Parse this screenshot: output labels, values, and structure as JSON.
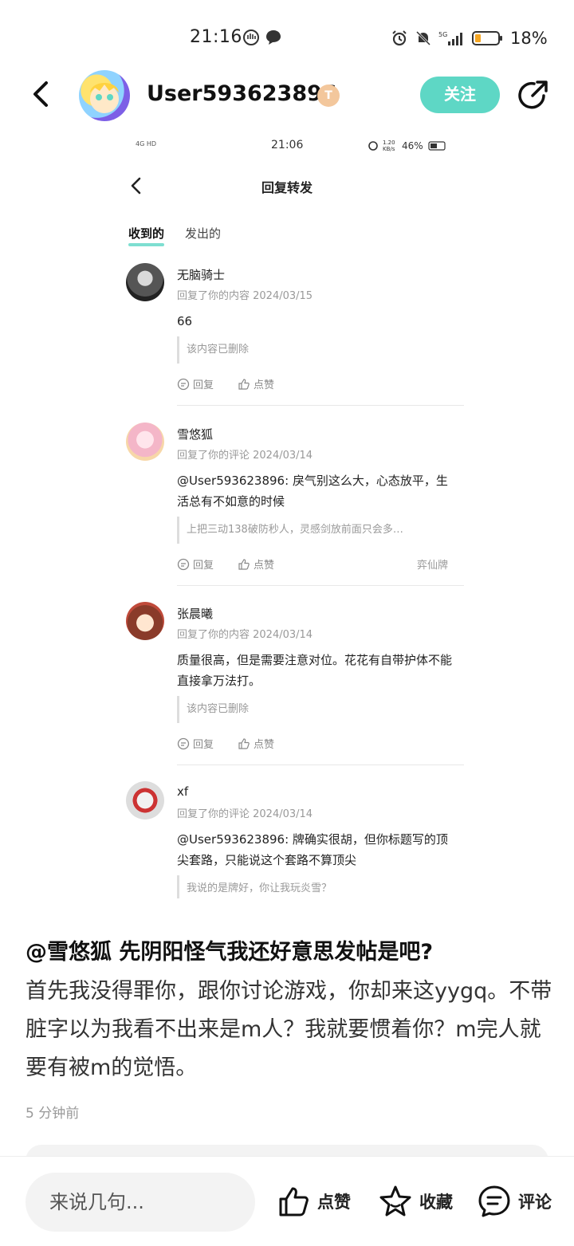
{
  "status_bar": {
    "time": "21:16",
    "battery": "18%"
  },
  "header": {
    "username": "User593623896",
    "level_badge": "T",
    "follow_label": "关注"
  },
  "screenshot": {
    "status": {
      "time": "21:06",
      "speed": "1.20 KB/s",
      "battery": "46%",
      "signal": "4G HD"
    },
    "title": "回复转发",
    "tabs": [
      "收到的",
      "发出的"
    ],
    "replies": [
      {
        "name": "无脑骑士",
        "meta": "回复了你的内容 2024/03/15",
        "text": "66",
        "quote": "该内容已删除",
        "reply_label": "回复",
        "like_label": "点赞",
        "tag": ""
      },
      {
        "name": "雪悠狐",
        "meta": "回复了你的评论 2024/03/14",
        "text": "@User593623896: 戾气别这么大，心态放平，生活总有不如意的时候",
        "quote": "上把三动138破防秒人，灵感剑放前面只会多…",
        "reply_label": "回复",
        "like_label": "点赞",
        "tag": "弈仙牌"
      },
      {
        "name": "张晨曦",
        "meta": "回复了你的内容 2024/03/14",
        "text": "质量很高，但是需要注意对位。花花有自带护体不能直接拿万法打。",
        "quote": "该内容已删除",
        "reply_label": "回复",
        "like_label": "点赞",
        "tag": ""
      },
      {
        "name": "xf",
        "meta": "回复了你的评论 2024/03/14",
        "text": "@User593623896: 牌确实很胡，但你标题写的顶尖套路，只能说这个套路不算顶尖",
        "quote": "我说的是牌好，你让我玩炎雪？",
        "reply_label": "",
        "like_label": "",
        "tag": ""
      }
    ]
  },
  "post": {
    "title": "@雪悠狐 先阴阳怪气我还好意思发帖是吧?",
    "body": "首先我没得罪你，跟你讨论游戏，你却来这yygq。不带脏字以为我看不出来是m人？我就要惯着你？m完人就要有被m的觉悟。",
    "time": "5 分钟前"
  },
  "bottom_bar": {
    "input_placeholder": "来说几句...",
    "like_label": "点赞",
    "favorite_label": "收藏",
    "comment_label": "评论"
  },
  "colors": {
    "accent": "#5ed7c5"
  }
}
